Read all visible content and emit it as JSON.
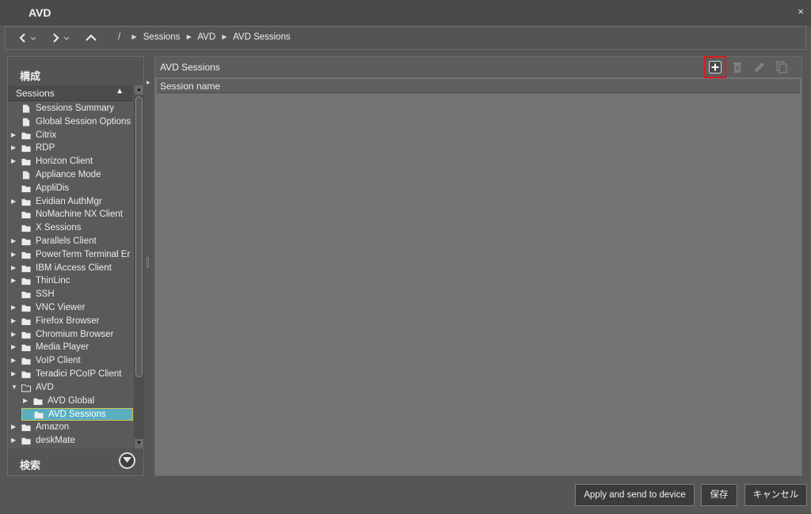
{
  "window": {
    "title": "AVD",
    "close_glyph": "×"
  },
  "nav": {
    "back_icon": "chevron-left-icon",
    "forward_icon": "chevron-right-icon",
    "up_icon": "chevron-up-icon",
    "root": "/",
    "breadcrumbs": [
      "Sessions",
      "AVD",
      "AVD Sessions"
    ]
  },
  "left": {
    "config_label": "構成",
    "sessions_header": "Sessions",
    "search_label": "検索",
    "tree": [
      {
        "label": "Sessions Summary",
        "icon": "page-icon"
      },
      {
        "label": "Global Session Options",
        "icon": "page-icon"
      },
      {
        "label": "Citrix",
        "icon": "folder-icon"
      },
      {
        "label": "RDP",
        "icon": "folder-icon"
      },
      {
        "label": "Horizon Client",
        "icon": "folder-icon"
      },
      {
        "label": "Appliance Mode",
        "icon": "page-icon"
      },
      {
        "label": "AppliDis",
        "icon": "folder-icon"
      },
      {
        "label": "Evidian AuthMgr",
        "icon": "folder-icon"
      },
      {
        "label": "NoMachine NX Client",
        "icon": "folder-icon"
      },
      {
        "label": "X Sessions",
        "icon": "folder-icon"
      },
      {
        "label": "Parallels Client",
        "icon": "folder-icon"
      },
      {
        "label": "PowerTerm Terminal Er",
        "icon": "folder-icon"
      },
      {
        "label": "IBM iAccess Client",
        "icon": "folder-icon"
      },
      {
        "label": "ThinLinc",
        "icon": "folder-icon"
      },
      {
        "label": "SSH",
        "icon": "folder-icon"
      },
      {
        "label": "VNC Viewer",
        "icon": "folder-icon"
      },
      {
        "label": "Firefox Browser",
        "icon": "folder-icon"
      },
      {
        "label": "Chromium Browser",
        "icon": "folder-icon"
      },
      {
        "label": "Media Player",
        "icon": "folder-icon"
      },
      {
        "label": "VoIP Client",
        "icon": "folder-icon"
      },
      {
        "label": "Teradici PCoIP Client",
        "icon": "folder-icon"
      },
      {
        "label": "AVD",
        "icon": "folder-open-icon"
      },
      {
        "label": "AVD Global",
        "icon": "folder-icon"
      },
      {
        "label": "AVD Sessions",
        "icon": "folder-icon"
      },
      {
        "label": "Amazon",
        "icon": "folder-icon"
      },
      {
        "label": "deskMate",
        "icon": "folder-icon"
      }
    ]
  },
  "right": {
    "title": "AVD Sessions",
    "column_header": "Session name",
    "tools": [
      "add-icon",
      "delete-icon",
      "edit-icon",
      "copy-icon"
    ]
  },
  "footer": {
    "apply_label": "Apply and send to device",
    "save_label": "保存",
    "cancel_label": "キャンセル"
  },
  "colors": {
    "selection": "#5aaebf",
    "highlight_outline": "#e0191f"
  }
}
